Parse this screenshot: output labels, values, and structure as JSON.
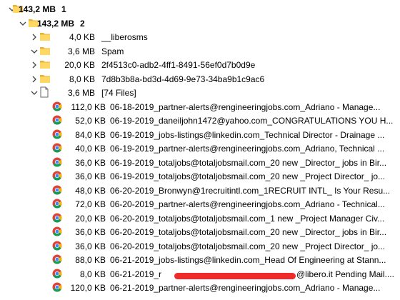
{
  "tree": [
    {
      "level": 0,
      "expand": "expanded",
      "icon": "folder",
      "size": "143,2 MB",
      "name": "1",
      "bold": true
    },
    {
      "level": 1,
      "expand": "expanded",
      "icon": "folder",
      "size": "143,2 MB",
      "name": "2",
      "bold": true
    },
    {
      "level": 2,
      "expand": "collapsed",
      "icon": "folder",
      "size": "4,0 KB",
      "name": "__liberosms"
    },
    {
      "level": 2,
      "expand": "expanded",
      "icon": "folder",
      "size": "3,6 MB",
      "name": "Spam"
    },
    {
      "level": 3,
      "expand": "collapsed",
      "icon": "folder",
      "size": "20,0 KB",
      "name": "2f4513c0-adb2-4ff1-8491-56ef0d7b0d9e"
    },
    {
      "level": 3,
      "expand": "collapsed",
      "icon": "folder",
      "size": "8,0 KB",
      "name": "7d8b3b8a-bd3d-4d69-9e73-34ba9b1c9ac6"
    },
    {
      "level": 3,
      "expand": "expanded",
      "icon": "file",
      "size": "3,6 MB",
      "name": "[74 Files]"
    },
    {
      "level": 4,
      "expand": "none",
      "icon": "chrome",
      "size": "112,0 KB",
      "name": "06-18-2019_partner-alerts@rengineeringjobs.com_Adriano - Manage..."
    },
    {
      "level": 4,
      "expand": "none",
      "icon": "chrome",
      "size": "52,0 KB",
      "name": "06-19-2019_daneiljohn1472@yahoo.com_CONGRATULATIONS YOU H..."
    },
    {
      "level": 4,
      "expand": "none",
      "icon": "chrome",
      "size": "84,0 KB",
      "name": "06-19-2019_jobs-listings@linkedin.com_Technical Director - Drainage ..."
    },
    {
      "level": 4,
      "expand": "none",
      "icon": "chrome",
      "size": "40,0 KB",
      "name": "06-19-2019_partner-alerts@rengineeringjobs.com_Adriano, Technical ..."
    },
    {
      "level": 4,
      "expand": "none",
      "icon": "chrome",
      "size": "36,0 KB",
      "name": "06-19-2019_totaljobs@totaljobsmail.com_20 new _Director_ jobs in Bir..."
    },
    {
      "level": 4,
      "expand": "none",
      "icon": "chrome",
      "size": "36,0 KB",
      "name": "06-19-2019_totaljobs@totaljobsmail.com_20 new _Project Director_ jo..."
    },
    {
      "level": 4,
      "expand": "none",
      "icon": "chrome",
      "size": "48,0 KB",
      "name": "06-20-2019_Bronwyn@1recruitintl.com_1RECRUIT INTL_  Is Your Resu..."
    },
    {
      "level": 4,
      "expand": "none",
      "icon": "chrome",
      "size": "72,0 KB",
      "name": "06-20-2019_partner-alerts@rengineeringjobs.com_Adriano - Technical..."
    },
    {
      "level": 4,
      "expand": "none",
      "icon": "chrome",
      "size": "20,0 KB",
      "name": "06-20-2019_totaljobs@totaljobsmail.com_1 new _Project Manager Civ..."
    },
    {
      "level": 4,
      "expand": "none",
      "icon": "chrome",
      "size": "36,0 KB",
      "name": "06-20-2019_totaljobs@totaljobsmail.com_20 new _Director_ jobs in Bir..."
    },
    {
      "level": 4,
      "expand": "none",
      "icon": "chrome",
      "size": "36,0 KB",
      "name": "06-20-2019_totaljobs@totaljobsmail.com_20 new _Project Director_ jo..."
    },
    {
      "level": 4,
      "expand": "none",
      "icon": "chrome",
      "size": "88,0 KB",
      "name": "06-21-2019_jobs-listings@linkedin.com_Head Of Engineering at Stann..."
    },
    {
      "level": 4,
      "expand": "none",
      "icon": "chrome",
      "size": "8,0 KB",
      "name": "06-21-2019_r",
      "name_tail": "@libero.it Pending Mail....",
      "redacted": true
    },
    {
      "level": 4,
      "expand": "none",
      "icon": "chrome",
      "size": "120,0 KB",
      "name": "06-21-2019_partner-alerts@rengineeringjobs.com_Adriano - Manage..."
    }
  ],
  "colors": {
    "folder_front": "#ffd864",
    "folder_back": "#e8b23a",
    "arrow": "#444444",
    "redaction": "#ee2a2a"
  },
  "icons": {
    "folder": "folder-icon",
    "file": "file-icon",
    "chrome": "chrome-icon",
    "expanded": "chevron-down-icon",
    "collapsed": "chevron-right-icon"
  }
}
